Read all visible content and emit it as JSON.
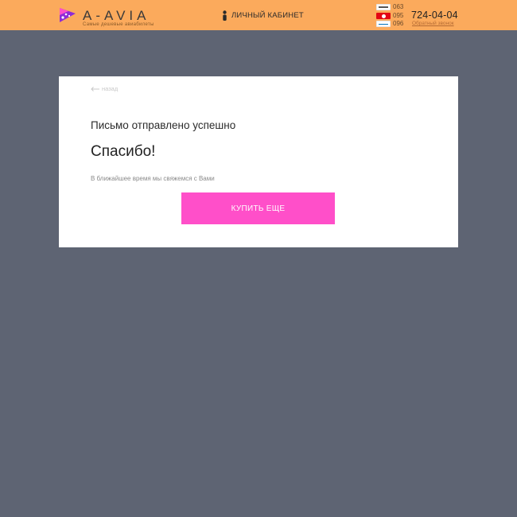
{
  "header": {
    "brand": {
      "name": "A-AVIA",
      "tagline": "Самые дешевые авиабилеты",
      "icon": "logo-mark-icon"
    },
    "cabinet": {
      "label": "ЛИЧНЫЙ КАБИНЕТ",
      "icon": "user-icon"
    },
    "operators": [
      {
        "name": "life:)",
        "code": "063"
      },
      {
        "name": "MTS",
        "code": "095"
      },
      {
        "name": "Kyivstar",
        "code": "096"
      }
    ],
    "phone": "724-04-04",
    "callback_label": "Обратный звонок",
    "colors": {
      "background": "#fbaa5c"
    }
  },
  "card": {
    "back_label": "назад",
    "status": "Письмо отправлено успешно",
    "title": "Спасибо!",
    "note": "В ближайшее время мы свяжемся с Вами",
    "buy_button_label": "КУПИТЬ ЕЩЕ"
  },
  "colors": {
    "page_background": "#5e6473",
    "accent": "#ff4fc9",
    "header": "#fbaa5c"
  }
}
